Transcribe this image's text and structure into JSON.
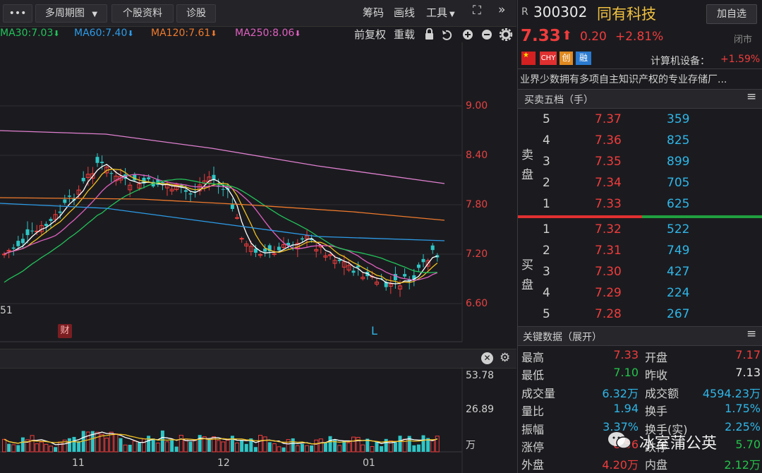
{
  "toolbar": {
    "dots": "•••",
    "period": "多周期图",
    "profile": "个股资料",
    "diagnose": "诊股",
    "chips": "筹码",
    "draw": "画线",
    "tools": "工具",
    "adjust": "前复权",
    "overlay": "重载"
  },
  "ma": [
    {
      "label": "MA30:7.03",
      "color": "#22c35a"
    },
    {
      "label": "MA60:7.40",
      "color": "#2d9be8"
    },
    {
      "label": "MA120:7.61",
      "color": "#f07a2c"
    },
    {
      "label": "MA250:8.06",
      "color": "#e060c0"
    }
  ],
  "price_axis": [
    "9.00",
    "8.40",
    "7.80",
    "7.20",
    "6.60"
  ],
  "left_label": "51",
  "cai_badge": "财",
  "l_marker": "L",
  "vol_axis": [
    "53.78",
    "26.89",
    "万"
  ],
  "x_axis": [
    "11",
    "12",
    "01"
  ],
  "stock": {
    "r_mark": "R",
    "code": "300302",
    "name": "同有科技",
    "watch_btn": "加自选",
    "price": "7.33",
    "change": "0.20",
    "pct": "+2.81%",
    "status": "闭市",
    "badges": [
      "CHY",
      "创",
      "融"
    ],
    "sector": "计算机设备：",
    "sector_pct": "+1.59%",
    "desc": "业界少数拥有多项自主知识产权的专业存储厂..."
  },
  "orderbook": {
    "title": "买卖五档（手）",
    "sell_label": [
      "卖",
      "盘"
    ],
    "buy_label": [
      "买",
      "盘"
    ],
    "asks": [
      {
        "lvl": "5",
        "price": "7.37",
        "vol": "359"
      },
      {
        "lvl": "4",
        "price": "7.36",
        "vol": "825"
      },
      {
        "lvl": "3",
        "price": "7.35",
        "vol": "899"
      },
      {
        "lvl": "2",
        "price": "7.34",
        "vol": "705"
      },
      {
        "lvl": "1",
        "price": "7.33",
        "vol": "625"
      }
    ],
    "bids": [
      {
        "lvl": "1",
        "price": "7.32",
        "vol": "522"
      },
      {
        "lvl": "2",
        "price": "7.31",
        "vol": "749"
      },
      {
        "lvl": "3",
        "price": "7.30",
        "vol": "427"
      },
      {
        "lvl": "4",
        "price": "7.29",
        "vol": "224"
      },
      {
        "lvl": "5",
        "price": "7.28",
        "vol": "267"
      }
    ]
  },
  "keydata": {
    "title": "关键数据（展开）",
    "rows": [
      {
        "l1": "最高",
        "v1": "7.33",
        "c1": "red",
        "l2": "开盘",
        "v2": "7.17",
        "c2": "red"
      },
      {
        "l1": "最低",
        "v1": "7.10",
        "c1": "green",
        "l2": "昨收",
        "v2": "7.13",
        "c2": "white"
      },
      {
        "l1": "成交量",
        "v1": "6.32万",
        "c1": "cyan",
        "l2": "成交额",
        "v2": "4594.23万",
        "c2": "cyan"
      },
      {
        "l1": "量比",
        "v1": "1.94",
        "c1": "cyan",
        "l2": "换手",
        "v2": "1.75%",
        "c2": "cyan"
      },
      {
        "l1": "振幅",
        "v1": "3.37%",
        "c1": "cyan",
        "l2": "换手(实)",
        "v2": "2.25%",
        "c2": "cyan"
      },
      {
        "l1": "涨停",
        "v1": "8.56",
        "c1": "red",
        "l2": "跌停",
        "v2": "5.70",
        "c2": "green"
      },
      {
        "l1": "外盘",
        "v1": "4.20万",
        "c1": "red",
        "l2": "内盘",
        "v2": "2.12万",
        "c2": "green"
      }
    ]
  },
  "watermark": "冰室蒲公英"
}
